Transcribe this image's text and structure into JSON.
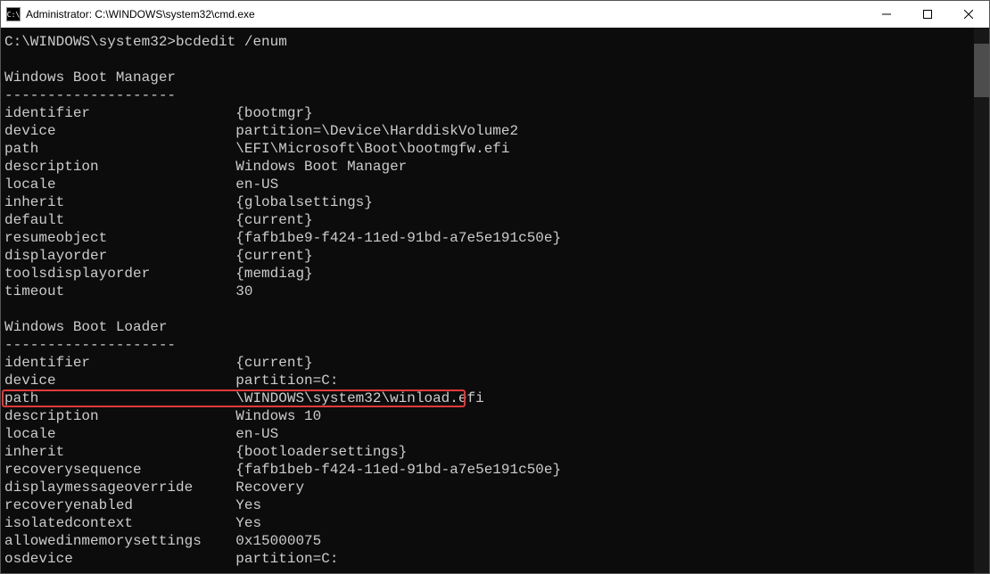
{
  "window": {
    "title": "Administrator: C:\\WINDOWS\\system32\\cmd.exe"
  },
  "prompt": {
    "path": "C:\\WINDOWS\\system32>",
    "command": "bcdedit /enum"
  },
  "sections": [
    {
      "heading": "Windows Boot Manager",
      "rows": [
        {
          "k": "identifier",
          "v": "{bootmgr}"
        },
        {
          "k": "device",
          "v": "partition=\\Device\\HarddiskVolume2"
        },
        {
          "k": "path",
          "v": "\\EFI\\Microsoft\\Boot\\bootmgfw.efi"
        },
        {
          "k": "description",
          "v": "Windows Boot Manager"
        },
        {
          "k": "locale",
          "v": "en-US"
        },
        {
          "k": "inherit",
          "v": "{globalsettings}"
        },
        {
          "k": "default",
          "v": "{current}"
        },
        {
          "k": "resumeobject",
          "v": "{fafb1be9-f424-11ed-91bd-a7e5e191c50e}"
        },
        {
          "k": "displayorder",
          "v": "{current}"
        },
        {
          "k": "toolsdisplayorder",
          "v": "{memdiag}"
        },
        {
          "k": "timeout",
          "v": "30"
        }
      ]
    },
    {
      "heading": "Windows Boot Loader",
      "rows": [
        {
          "k": "identifier",
          "v": "{current}"
        },
        {
          "k": "device",
          "v": "partition=C:"
        },
        {
          "k": "path",
          "v": "\\WINDOWS\\system32\\winload.efi",
          "highlight": true
        },
        {
          "k": "description",
          "v": "Windows 10"
        },
        {
          "k": "locale",
          "v": "en-US"
        },
        {
          "k": "inherit",
          "v": "{bootloadersettings}"
        },
        {
          "k": "recoverysequence",
          "v": "{fafb1beb-f424-11ed-91bd-a7e5e191c50e}"
        },
        {
          "k": "displaymessageoverride",
          "v": "Recovery"
        },
        {
          "k": "recoveryenabled",
          "v": "Yes"
        },
        {
          "k": "isolatedcontext",
          "v": "Yes"
        },
        {
          "k": "allowedinmemorysettings",
          "v": "0x15000075"
        },
        {
          "k": "osdevice",
          "v": "partition=C:"
        }
      ]
    }
  ],
  "divider": "--------------------"
}
